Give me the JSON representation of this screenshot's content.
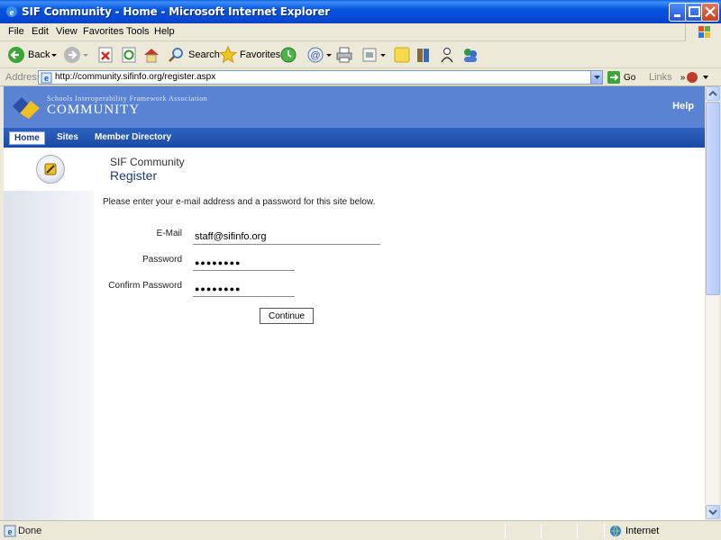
{
  "window": {
    "title": "SIF Community - Home - Microsoft Internet Explorer"
  },
  "menu": [
    "File",
    "Edit",
    "View",
    "Favorites",
    "Tools",
    "Help"
  ],
  "toolbar": {
    "back_label": "Back",
    "search_label": "Search",
    "favorites_label": "Favorites"
  },
  "address": {
    "label": "Address",
    "url": "http://community.sifinfo.org/register.aspx",
    "go_label": "Go",
    "links_label": "Links",
    "chevron": "»"
  },
  "site": {
    "org_name": "Schools Interoperability Framework Association",
    "name": "COMMUNITY",
    "help": "Help",
    "nav": [
      "Home",
      "Sites",
      "Member Directory"
    ]
  },
  "page": {
    "breadcrumb": "SIF Community",
    "title": "Register",
    "instructions": "Please enter your e-mail address and a password for this site below."
  },
  "form": {
    "email_label": "E-Mail",
    "email_value": "staff@sifinfo.org",
    "password_label": "Password",
    "password_value": "●●●●●●●●",
    "confirm_label": "Confirm Password",
    "confirm_value": "●●●●●●●●",
    "continue_label": "Continue"
  },
  "status": {
    "text": "Done",
    "zone": "Internet"
  },
  "colors": {
    "title_bar": "#0854e0",
    "header": "#5a84d3",
    "nav": "#1a4aa5",
    "chrome": "#ece9d8"
  }
}
